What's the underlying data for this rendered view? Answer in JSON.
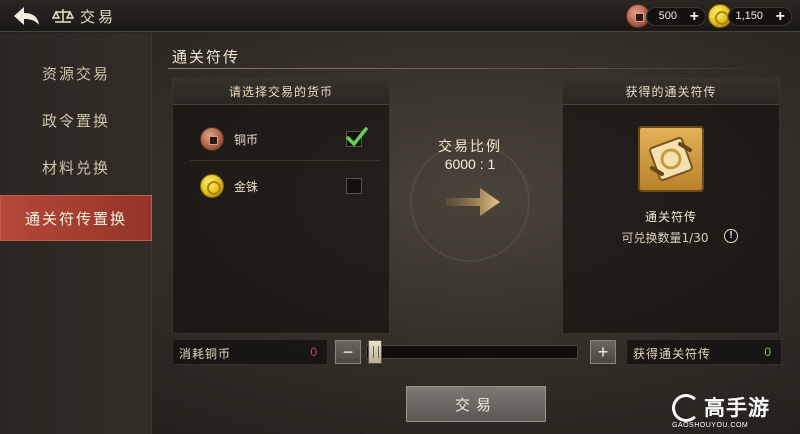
{
  "header": {
    "title": "交易",
    "copper_amount": "500",
    "gold_amount": "1,150"
  },
  "sidebar": {
    "items": [
      {
        "label": "资源交易",
        "active": false
      },
      {
        "label": "政令置换",
        "active": false
      },
      {
        "label": "材料兑换",
        "active": false
      },
      {
        "label": "通关符传置换",
        "active": true
      }
    ]
  },
  "main": {
    "section_title": "通关符传",
    "left_panel": {
      "header": "请选择交易的货币",
      "currencies": [
        {
          "name": "铜币",
          "icon": "copper-coin-icon",
          "checked": true
        },
        {
          "name": "金铢",
          "icon": "gold-coin-icon",
          "checked": false
        }
      ]
    },
    "ratio": {
      "label": "交易比例",
      "value": "6000 : 1"
    },
    "right_panel": {
      "header": "获得的通关符传",
      "reward_icon": "scroll-icon",
      "reward_name": "通关符传",
      "limit_text": "可兑换数量1/30",
      "info": "!"
    }
  },
  "footer": {
    "consume_label": "消耗铜币",
    "consume_value": "0",
    "gain_label": "获得通关符传",
    "gain_value": "0",
    "minus": "−",
    "plus": "+",
    "slider_fraction": 0,
    "trade_button": "交易"
  },
  "watermark": {
    "name": "高手游",
    "url": "GAOSHOUYOU.COM"
  },
  "colors": {
    "active_tab": "#b4483a",
    "consume_value": "#e04040",
    "gain_value": "#6fd24a",
    "check": "#5fd05a"
  }
}
